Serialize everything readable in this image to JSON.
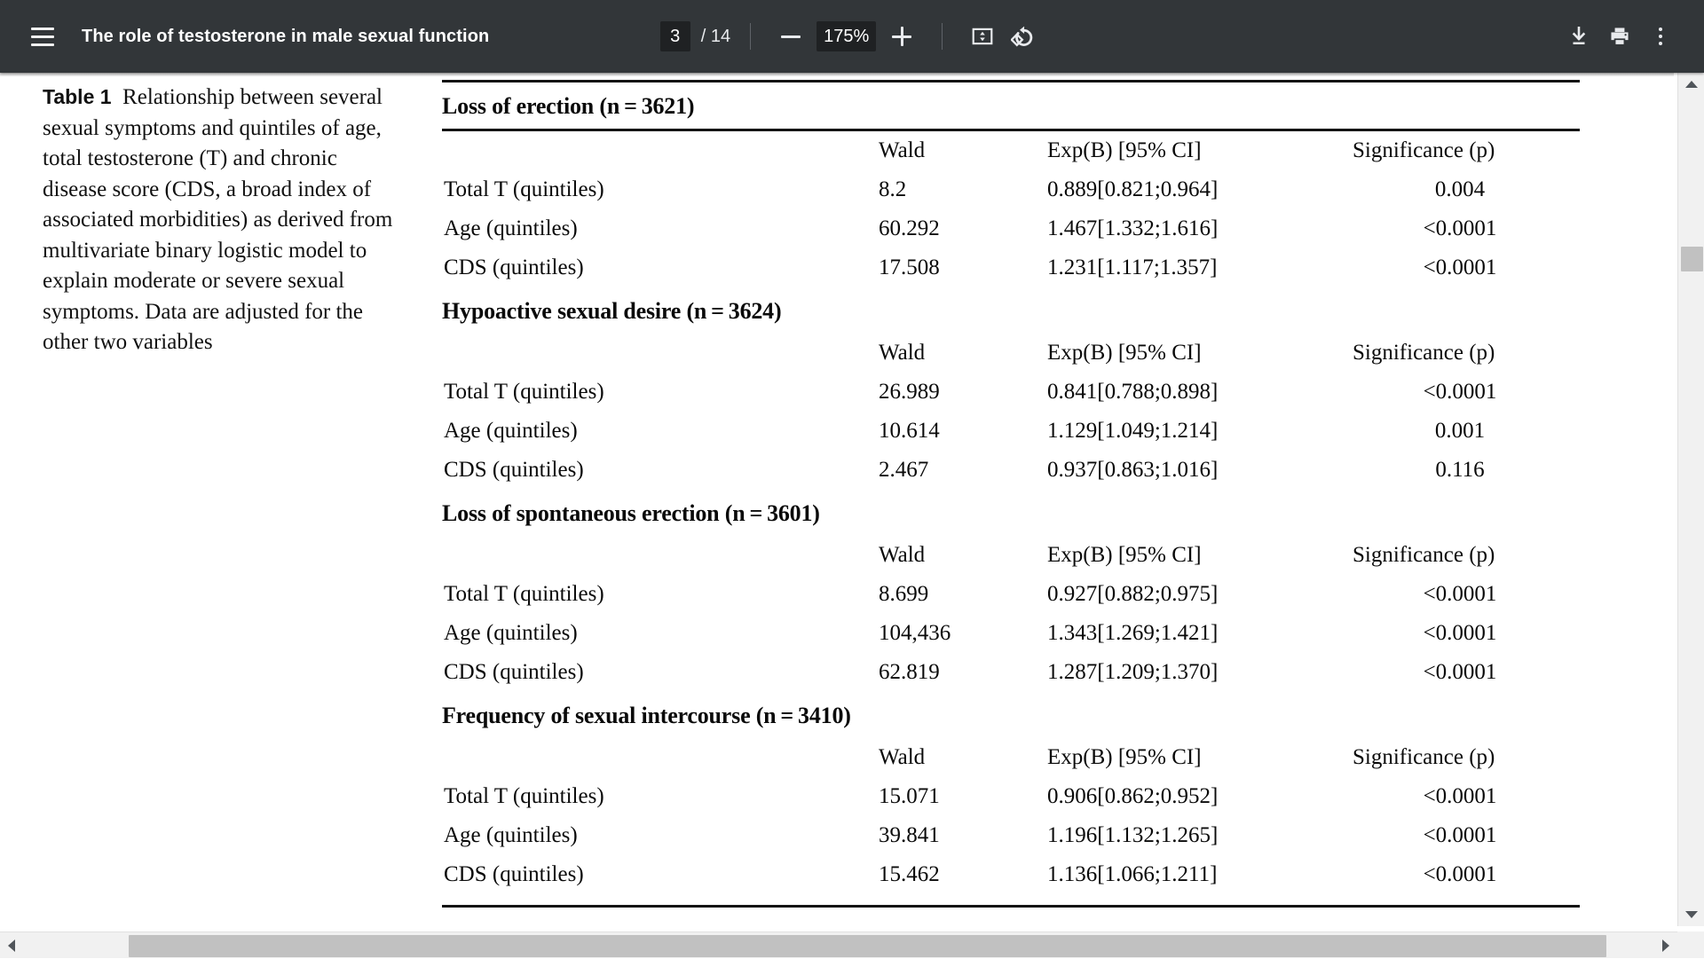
{
  "toolbar": {
    "menu_icon": "hamburger-menu-icon",
    "title": "The role of testosterone in male sexual function",
    "page_current": "3",
    "page_total": "/ 14",
    "zoom_out_icon": "minus-icon",
    "zoom_level": "175%",
    "zoom_in_icon": "plus-icon",
    "fit_icon": "fit-to-page-icon",
    "rotate_icon": "rotate-counterclockwise-icon",
    "download_icon": "download-icon",
    "print_icon": "print-icon",
    "more_icon": "more-vertical-icon"
  },
  "caption": {
    "label": "Table 1",
    "text": "Relationship between several sexual symptoms and quintiles of age, total testosterone (T) and chronic disease score (CDS, a broad index of associated morbidities) as derived from multivariate binary logistic model to explain moderate or severe sexual symptoms. Data are adjusted for the other two variables"
  },
  "table": {
    "columns": [
      "",
      "Wald",
      "Exp(B) [95% CI]",
      "Significance (p)"
    ],
    "sections": [
      {
        "title": "Loss of erection (n = 3621)",
        "rows": [
          {
            "label": "Total T (quintiles)",
            "wald": "8.2",
            "exp": "0.889[0.821;0.964]",
            "sig": "0.004"
          },
          {
            "label": "Age (quintiles)",
            "wald": "60.292",
            "exp": "1.467[1.332;1.616]",
            "sig": "<0.0001"
          },
          {
            "label": "CDS (quintiles)",
            "wald": "17.508",
            "exp": "1.231[1.117;1.357]",
            "sig": "<0.0001"
          }
        ]
      },
      {
        "title": "Hypoactive sexual desire (n = 3624)",
        "rows": [
          {
            "label": "Total T (quintiles)",
            "wald": "26.989",
            "exp": "0.841[0.788;0.898]",
            "sig": "<0.0001"
          },
          {
            "label": "Age (quintiles)",
            "wald": "10.614",
            "exp": "1.129[1.049;1.214]",
            "sig": "0.001"
          },
          {
            "label": "CDS (quintiles)",
            "wald": "2.467",
            "exp": "0.937[0.863;1.016]",
            "sig": "0.116"
          }
        ]
      },
      {
        "title": "Loss of spontaneous erection (n = 3601)",
        "rows": [
          {
            "label": "Total T (quintiles)",
            "wald": "8.699",
            "exp": "0.927[0.882;0.975]",
            "sig": "<0.0001"
          },
          {
            "label": "Age (quintiles)",
            "wald": "104,436",
            "exp": "1.343[1.269;1.421]",
            "sig": "<0.0001"
          },
          {
            "label": "CDS (quintiles)",
            "wald": "62.819",
            "exp": "1.287[1.209;1.370]",
            "sig": "<0.0001"
          }
        ]
      },
      {
        "title": "Frequency of sexual intercourse (n = 3410)",
        "rows": [
          {
            "label": "Total T (quintiles)",
            "wald": "15.071",
            "exp": "0.906[0.862;0.952]",
            "sig": "<0.0001"
          },
          {
            "label": "Age (quintiles)",
            "wald": "39.841",
            "exp": "1.196[1.132;1.265]",
            "sig": "<0.0001"
          },
          {
            "label": "CDS (quintiles)",
            "wald": "15.462",
            "exp": "1.136[1.066;1.211]",
            "sig": "<0.0001"
          }
        ]
      }
    ]
  },
  "colors": {
    "toolbar_bg": "#323639",
    "field_bg": "#1f2123",
    "page_bg": "#ffffff",
    "scrollbar_track": "#f1f1f1",
    "scrollbar_thumb": "#c1c1c1"
  }
}
